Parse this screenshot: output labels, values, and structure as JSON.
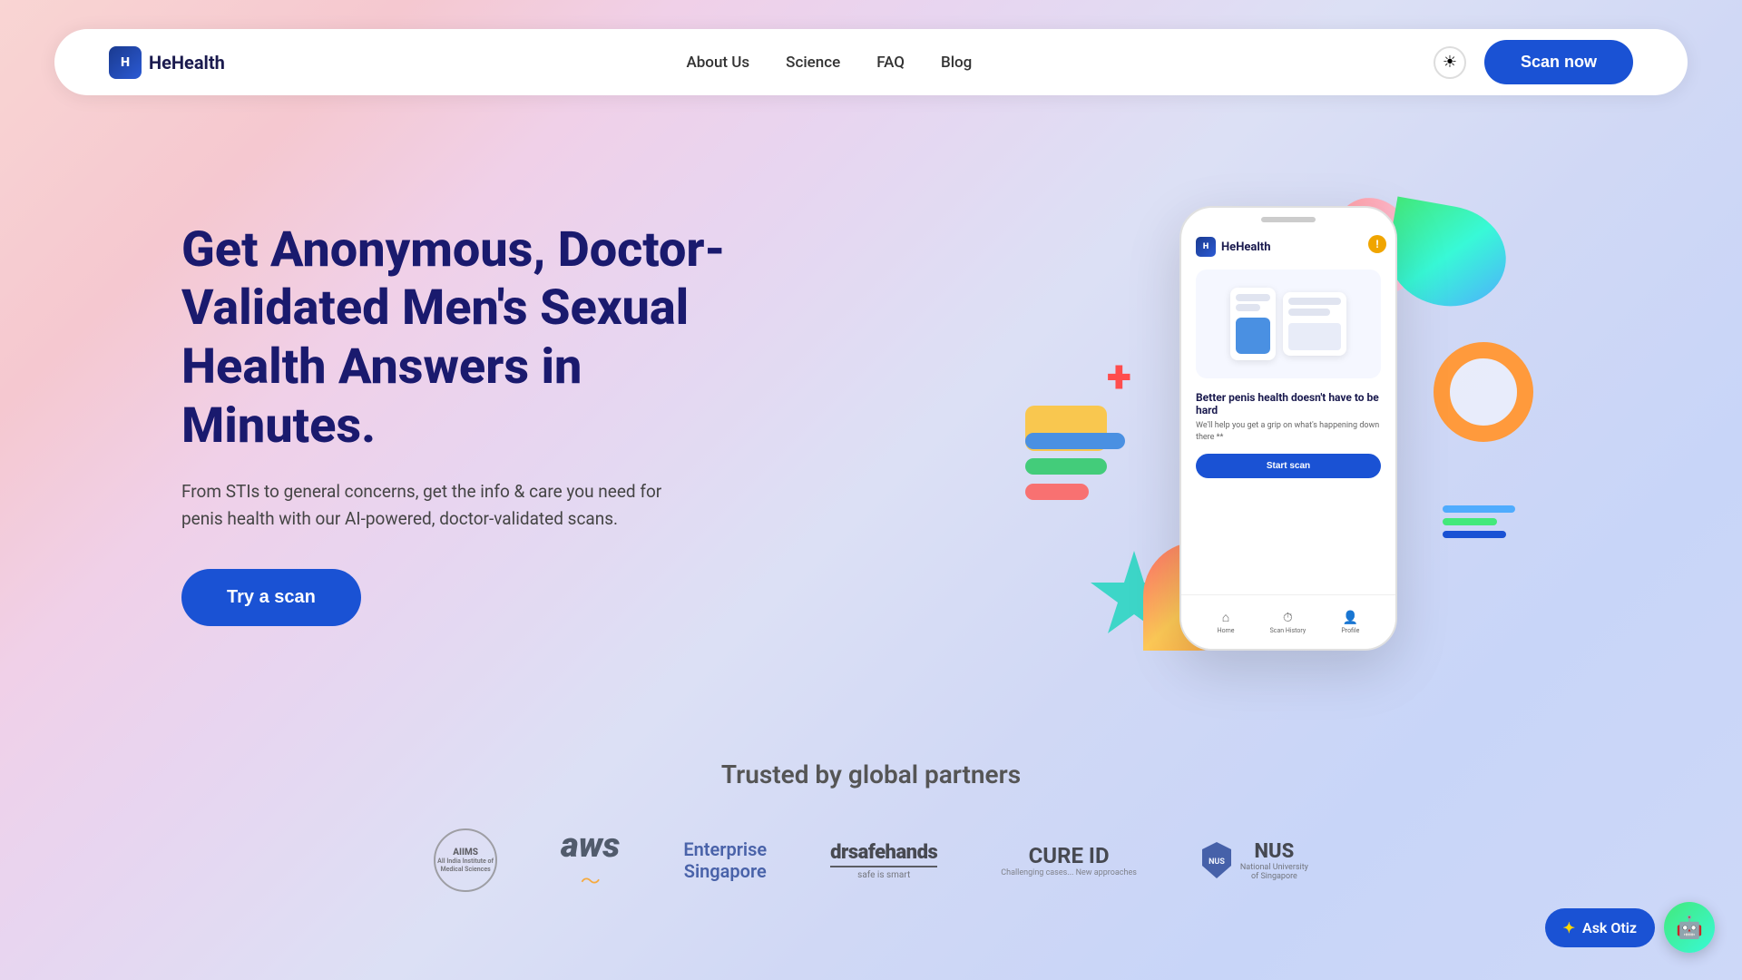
{
  "brand": {
    "name": "HeHealth",
    "logo_symbol": "H"
  },
  "nav": {
    "links": [
      {
        "label": "About Us",
        "id": "about"
      },
      {
        "label": "Science",
        "id": "science"
      },
      {
        "label": "FAQ",
        "id": "faq"
      },
      {
        "label": "Blog",
        "id": "blog"
      }
    ],
    "scan_button": "Scan now",
    "theme_icon": "☀"
  },
  "hero": {
    "title": "Get Anonymous, Doctor-Validated Men's Sexual Health Answers in Minutes.",
    "subtitle": "From STIs to general concerns, get the info & care you need for penis health with our AI-powered, doctor-validated scans.",
    "cta_button": "Try a scan",
    "phone": {
      "logo": "HeHealth",
      "app_title": "Better penis health doesn't have to be hard",
      "app_body": "We'll help you get a grip on what's happening down there **",
      "start_btn": "Start scan",
      "bottom_tabs": [
        {
          "icon": "⌂",
          "label": "Home"
        },
        {
          "icon": "⏱",
          "label": "Scan History"
        },
        {
          "icon": "👤",
          "label": "Profile"
        }
      ]
    }
  },
  "trusted": {
    "title": "Trusted by global partners",
    "partners": [
      {
        "name": "AIIMS",
        "display": "AIIMS"
      },
      {
        "name": "AWS",
        "display": "aws"
      },
      {
        "name": "Enterprise Singapore",
        "display": "Enterprise\nSingapore"
      },
      {
        "name": "drsafehands",
        "display": "drsafehands"
      },
      {
        "name": "CURE ID",
        "display": "CURE ID"
      },
      {
        "name": "NUS",
        "display": "NUS"
      }
    ]
  },
  "chat": {
    "label": "Ask Otiz",
    "star_icon": "✦"
  },
  "colors": {
    "primary": "#1a52d4",
    "dark_navy": "#1a1a6e",
    "text_body": "#444444"
  }
}
